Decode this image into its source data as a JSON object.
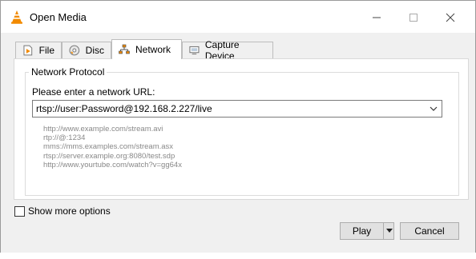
{
  "window": {
    "title": "Open Media"
  },
  "tabs": [
    {
      "label": "File",
      "icon": "file-play-icon"
    },
    {
      "label": "Disc",
      "icon": "disc-icon"
    },
    {
      "label": "Network",
      "icon": "network-icon",
      "active": true
    },
    {
      "label": "Capture Device",
      "icon": "capture-device-icon"
    }
  ],
  "network": {
    "group_title": "Network Protocol",
    "prompt": "Please enter a network URL:",
    "url_value": "rtsp://user:Password@192.168.2.227/live",
    "examples": [
      "http://www.example.com/stream.avi",
      "rtp://@:1234",
      "mms://mms.examples.com/stream.asx",
      "rtsp://server.example.org:8080/test.sdp",
      "http://www.yourtube.com/watch?v=gg64x"
    ]
  },
  "options": {
    "show_more_label": "Show more options",
    "show_more_checked": false
  },
  "buttons": {
    "play": "Play",
    "cancel": "Cancel"
  },
  "colors": {
    "vlc_orange": "#f28a00",
    "background": "#f0f0f0",
    "panel": "#ffffff"
  }
}
